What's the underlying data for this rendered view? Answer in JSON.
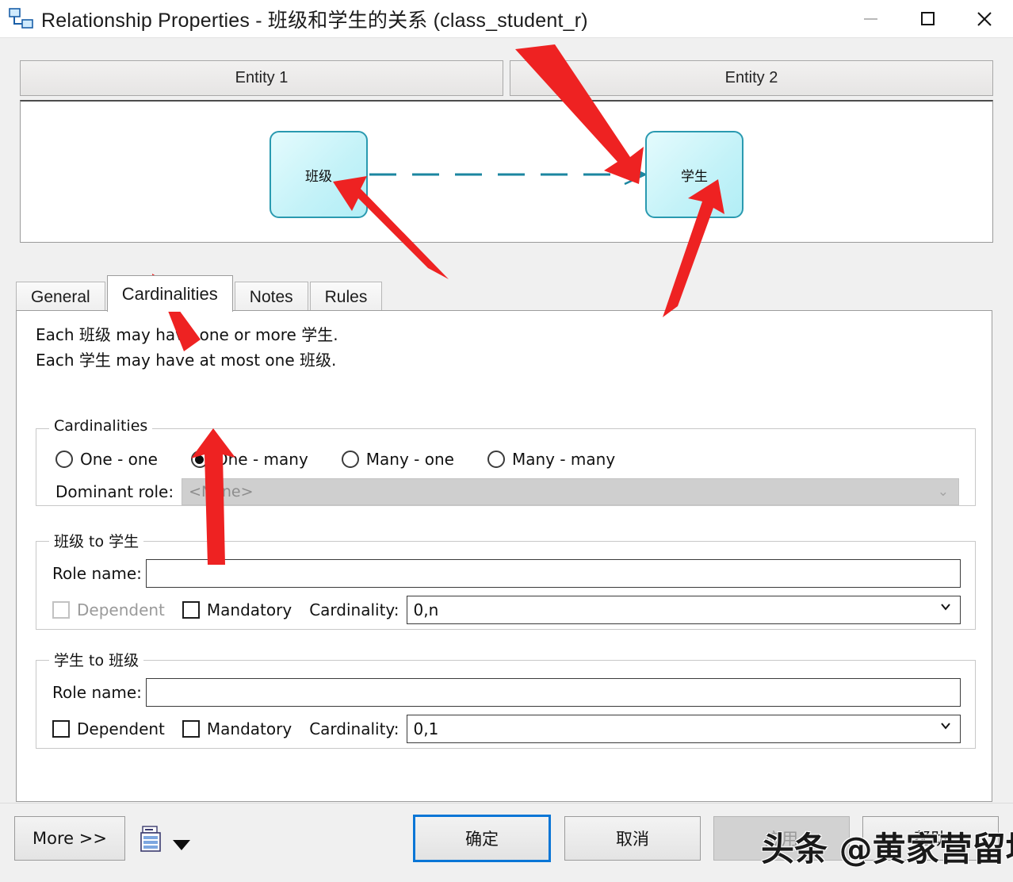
{
  "window": {
    "title": "Relationship Properties - 班级和学生的关系 (class_student_r)",
    "icon": "relationship-icon",
    "controls": {
      "minimize": "—",
      "maximize": "□",
      "close": "✕"
    }
  },
  "entities": {
    "header1": "Entity 1",
    "header2": "Entity 2",
    "box1_label": "班级",
    "box2_label": "学生",
    "line_style": "dashed",
    "right_end": "crow-foot",
    "border_color": "#2a9ab0",
    "fill_color": "#c3f2f8"
  },
  "tabs": [
    {
      "label": "General",
      "active": false
    },
    {
      "label": "Cardinalities",
      "active": true
    },
    {
      "label": "Notes",
      "active": false
    },
    {
      "label": "Rules",
      "active": false
    }
  ],
  "description": {
    "line1": "Each 班级 may have one or more 学生.",
    "line2": "Each 学生 may have at most one 班级."
  },
  "cardinalities_group": {
    "legend": "Cardinalities",
    "options": [
      {
        "label": "One - one",
        "selected": false
      },
      {
        "label": "One - many",
        "selected": true
      },
      {
        "label": "Many - one",
        "selected": false
      },
      {
        "label": "Many - many",
        "selected": false
      }
    ],
    "dominant_role_label": "Dominant role:",
    "dominant_role_value": "<None>",
    "dominant_role_disabled": true
  },
  "role_a_to_b": {
    "legend": "班级 to 学生",
    "role_name_label": "Role name:",
    "role_name_value": "",
    "dependent_label": "Dependent",
    "dependent_checked": false,
    "dependent_disabled": true,
    "mandatory_label": "Mandatory",
    "mandatory_checked": false,
    "cardinality_label": "Cardinality:",
    "cardinality_value": "0,n"
  },
  "role_b_to_a": {
    "legend": "学生 to 班级",
    "role_name_label": "Role name:",
    "role_name_value": "",
    "dependent_label": "Dependent",
    "dependent_checked": false,
    "dependent_disabled": false,
    "mandatory_label": "Mandatory",
    "mandatory_checked": false,
    "cardinality_label": "Cardinality:",
    "cardinality_value": "0,1"
  },
  "buttons": {
    "more": "More >>",
    "report_icon": "report-icon",
    "report_caret": "caret-down-icon",
    "ok": "确定",
    "cancel": "取消",
    "apply": "应用",
    "help": "帮助",
    "ok_focus_color": "#0a76d6",
    "apply_disabled": true
  },
  "watermark": "头条 @黄家营留地",
  "annotations": {
    "arrow_color": "#ee2222",
    "arrows": [
      "points-to-entity2-box",
      "points-to-entity1-box",
      "points-to-cardinalities-tab",
      "points-to-one-many-radio",
      "points-to-student-entity"
    ]
  }
}
